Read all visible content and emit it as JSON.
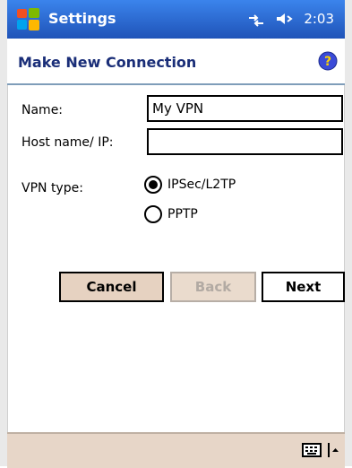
{
  "titlebar": {
    "app_title": "Settings",
    "time": "2:03"
  },
  "header": {
    "title": "Make New Connection"
  },
  "form": {
    "name_label": "Name:",
    "name_value": "My VPN",
    "host_label": "Host name/ IP:",
    "host_value": "",
    "vpn_type_label": "VPN type:",
    "vpn_options": [
      {
        "label": "IPSec/L2TP",
        "selected": true
      },
      {
        "label": "PPTP",
        "selected": false
      }
    ]
  },
  "buttons": {
    "cancel": "Cancel",
    "back": "Back",
    "next": "Next"
  },
  "colors": {
    "titlebar": "#2f6fd6",
    "header_text": "#1a2e78",
    "toolbar": "#e7d6c8"
  },
  "icons": {
    "start": "windows-flag-icon",
    "connectivity": "connectivity-icon",
    "volume": "volume-icon",
    "help": "help-icon",
    "keyboard": "keyboard-icon",
    "sip_arrow": "up-arrow-icon"
  }
}
